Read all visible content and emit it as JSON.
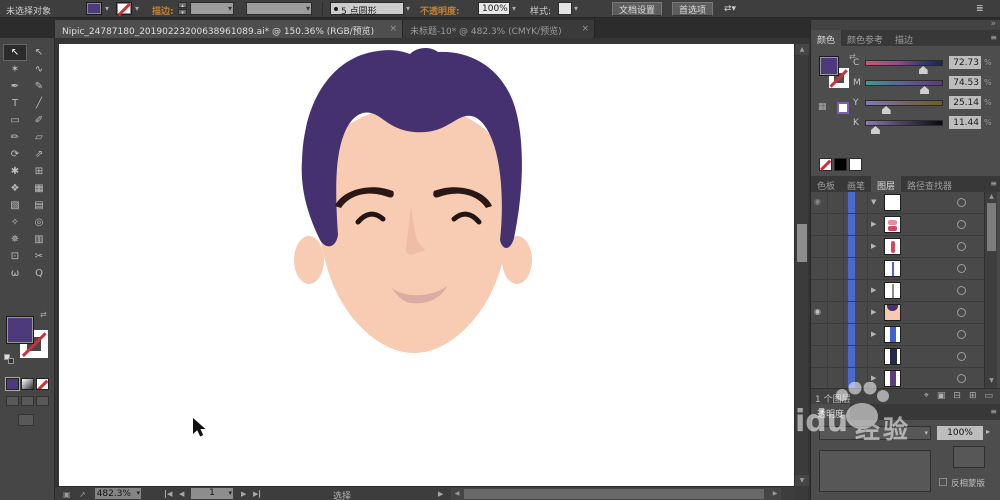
{
  "control_bar": {
    "status": "未选择对象",
    "stroke_label": "描边:",
    "point_style": "5 点圆形",
    "opacity_label": "不透明度:",
    "opacity_value": "100%",
    "style_label": "样式:",
    "document_setup": "文档设置",
    "preferences": "首选项"
  },
  "document_tabs": [
    {
      "title": "Nipic_24787180_20190223200638961089.ai* @ 150.36% (RGB/预览)",
      "close": "×"
    },
    {
      "title": "未标题-10* @ 482.3% (CMYK/预览)",
      "close": "×"
    }
  ],
  "toolbar": {
    "tools": [
      {
        "name": "selection-tool",
        "glyph": "↖",
        "selected": true
      },
      {
        "name": "direct-selection-tool",
        "glyph": "↖",
        "selected": false
      },
      {
        "name": "magic-wand-tool",
        "glyph": "✶",
        "selected": false
      },
      {
        "name": "lasso-tool",
        "glyph": "∿",
        "selected": false
      },
      {
        "name": "pen-tool",
        "glyph": "✒",
        "selected": false
      },
      {
        "name": "curvature-tool",
        "glyph": "✎",
        "selected": false
      },
      {
        "name": "type-tool",
        "glyph": "T",
        "selected": false
      },
      {
        "name": "line-segment-tool",
        "glyph": "╱",
        "selected": false
      },
      {
        "name": "rectangle-tool",
        "glyph": "▭",
        "selected": false
      },
      {
        "name": "paintbrush-tool",
        "glyph": "✐",
        "selected": false
      },
      {
        "name": "pencil-tool",
        "glyph": "✏",
        "selected": false
      },
      {
        "name": "eraser-tool",
        "glyph": "▱",
        "selected": false
      },
      {
        "name": "rotate-tool",
        "glyph": "⟳",
        "selected": false
      },
      {
        "name": "scale-tool",
        "glyph": "⇗",
        "selected": false
      },
      {
        "name": "width-tool",
        "glyph": "✱",
        "selected": false
      },
      {
        "name": "free-transform-tool",
        "glyph": "⊞",
        "selected": false
      },
      {
        "name": "shape-builder-tool",
        "glyph": "❖",
        "selected": false
      },
      {
        "name": "perspective-grid-tool",
        "glyph": "▦",
        "selected": false
      },
      {
        "name": "mesh-tool",
        "glyph": "▧",
        "selected": false
      },
      {
        "name": "gradient-tool",
        "glyph": "▤",
        "selected": false
      },
      {
        "name": "eyedropper-tool",
        "glyph": "✧",
        "selected": false
      },
      {
        "name": "blend-tool",
        "glyph": "◎",
        "selected": false
      },
      {
        "name": "symbol-sprayer-tool",
        "glyph": "✵",
        "selected": false
      },
      {
        "name": "column-graph-tool",
        "glyph": "▥",
        "selected": false
      },
      {
        "name": "artboard-tool",
        "glyph": "⊡",
        "selected": false
      },
      {
        "name": "slice-tool",
        "glyph": "✂",
        "selected": false
      },
      {
        "name": "hand-tool",
        "glyph": "ω",
        "selected": false
      },
      {
        "name": "zoom-tool",
        "glyph": "Q",
        "selected": false
      }
    ]
  },
  "color_panel": {
    "tabs": [
      "颜色",
      "颜色参考",
      "描边"
    ],
    "unit": "%",
    "channels": [
      {
        "label": "C",
        "value": "72.73"
      },
      {
        "label": "M",
        "value": "74.53"
      },
      {
        "label": "Y",
        "value": "25.14"
      },
      {
        "label": "K",
        "value": "11.44"
      }
    ]
  },
  "middle_tabs": [
    "色板",
    "画笔",
    "图层",
    "路径查找器"
  ],
  "layers_panel": {
    "status": "1 个图层",
    "rows": [
      {
        "eye": "dim",
        "disclosure": "down",
        "thumb": "blank"
      },
      {
        "eye": false,
        "disclosure": "right",
        "thumb": "lips"
      },
      {
        "eye": false,
        "disclosure": "right",
        "thumb": "redbar"
      },
      {
        "eye": false,
        "disclosure": null,
        "thumb": "blueline"
      },
      {
        "eye": false,
        "disclosure": "right",
        "thumb": "grayline"
      },
      {
        "eye": true,
        "disclosure": "right",
        "thumb": "face"
      },
      {
        "eye": false,
        "disclosure": "right",
        "thumb": "bluebar"
      },
      {
        "eye": false,
        "disclosure": null,
        "thumb": "navybar"
      },
      {
        "eye": false,
        "disclosure": "right",
        "thumb": "purplebar"
      },
      {
        "eye": false,
        "disclosure": "right",
        "thumb": "darkbar"
      }
    ],
    "buttons": [
      {
        "name": "locate-object-icon",
        "glyph": "⌖"
      },
      {
        "name": "make-clip-mask-icon",
        "glyph": "▣"
      },
      {
        "name": "new-sublayer-icon",
        "glyph": "⊟"
      },
      {
        "name": "new-layer-icon",
        "glyph": "⊞"
      },
      {
        "name": "delete-layer-icon",
        "glyph": "▭"
      }
    ]
  },
  "transparency_panel": {
    "tab": "透明度",
    "opacity_value": "100%",
    "invert_mask_label": "反相蒙版"
  },
  "status_bar": {
    "zoom": "482.3%",
    "artboard_number": "1",
    "tool_name": "选择"
  },
  "watermark": {
    "latin": "idu",
    "text": "经验"
  },
  "icons": {
    "dropdown_arrow": "▾",
    "stepper_up": "▴",
    "stepper_down": "▾",
    "panel_menu": "≡",
    "dock_collapse": "»",
    "workspace_list": "≣",
    "swap_arrows": "⇄",
    "transform_arrows": "⇄▾",
    "scroll_up": "▲",
    "scroll_down": "▼",
    "nav_prev": "◀",
    "nav_next": "▶",
    "eye": "◉",
    "disclosure_right": "▶",
    "disclosure_down": "▼",
    "popout": "▸",
    "status_icon_a": "▣",
    "status_icon_b": "↗"
  },
  "artwork": {
    "colors": {
      "hair": "#453170",
      "skin": "#F8CBB3",
      "brow": "#2B1715",
      "eye": "#241515",
      "nose": "#EFBCA6",
      "mouth": "#D9ACA4"
    }
  }
}
